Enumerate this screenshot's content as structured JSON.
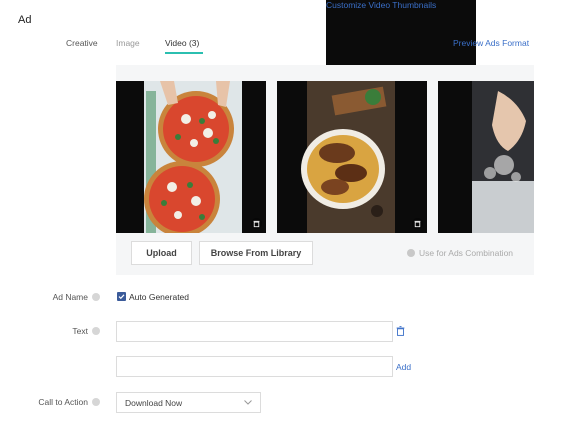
{
  "section": {
    "title": "Ad"
  },
  "creative": {
    "label": "Creative",
    "tabs": [
      {
        "label": "Image",
        "active": false
      },
      {
        "label": "Video (3)",
        "active": true
      }
    ],
    "links": {
      "customize": "Customize Video Thumbnails",
      "preview": "Preview Ads Format"
    }
  },
  "media": {
    "videos": [
      {
        "icon": "trash-icon"
      },
      {
        "icon": "trash-icon"
      },
      {
        "icon": "trash-icon"
      }
    ],
    "buttons": {
      "upload": "Upload",
      "browse": "Browse From Library"
    },
    "combination_hint": "Use for Ads Combination"
  },
  "ad_name": {
    "label": "Ad Name",
    "checkbox_label": "Auto Generated",
    "checked": true
  },
  "text": {
    "label": "Text",
    "inputs": [
      {
        "value": "",
        "placeholder": ""
      },
      {
        "value": "",
        "placeholder": ""
      }
    ],
    "add_label": "Add"
  },
  "cta": {
    "label": "Call to Action",
    "value": "Download Now"
  },
  "colors": {
    "accent": "#2bbfb0",
    "link": "#3a6fc8",
    "checkbox": "#3b5b9a"
  }
}
